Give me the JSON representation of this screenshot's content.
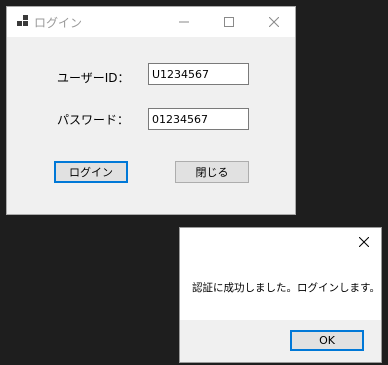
{
  "login_window": {
    "title": "ログイン",
    "app_icon": "form-icon",
    "controls": {
      "minimize_icon": "minimize-icon",
      "maximize_icon": "maximize-icon",
      "close_icon": "close-icon"
    },
    "user_id": {
      "label": "ユーザーID：",
      "value": "U1234567"
    },
    "password": {
      "label": "パスワード：",
      "value": "01234567"
    },
    "login_button_label": "ログイン",
    "close_button_label": "閉じる"
  },
  "message_box": {
    "close_icon": "close-icon",
    "message": "認証に成功しました。ログインします。",
    "ok_button_label": "OK"
  },
  "colors": {
    "desktop_background": "#1e1e1e",
    "window_background": "#f0f0f0",
    "titlebar_background": "#ffffff",
    "focus_accent": "#0078d7",
    "button_face": "#e1e1e1"
  }
}
